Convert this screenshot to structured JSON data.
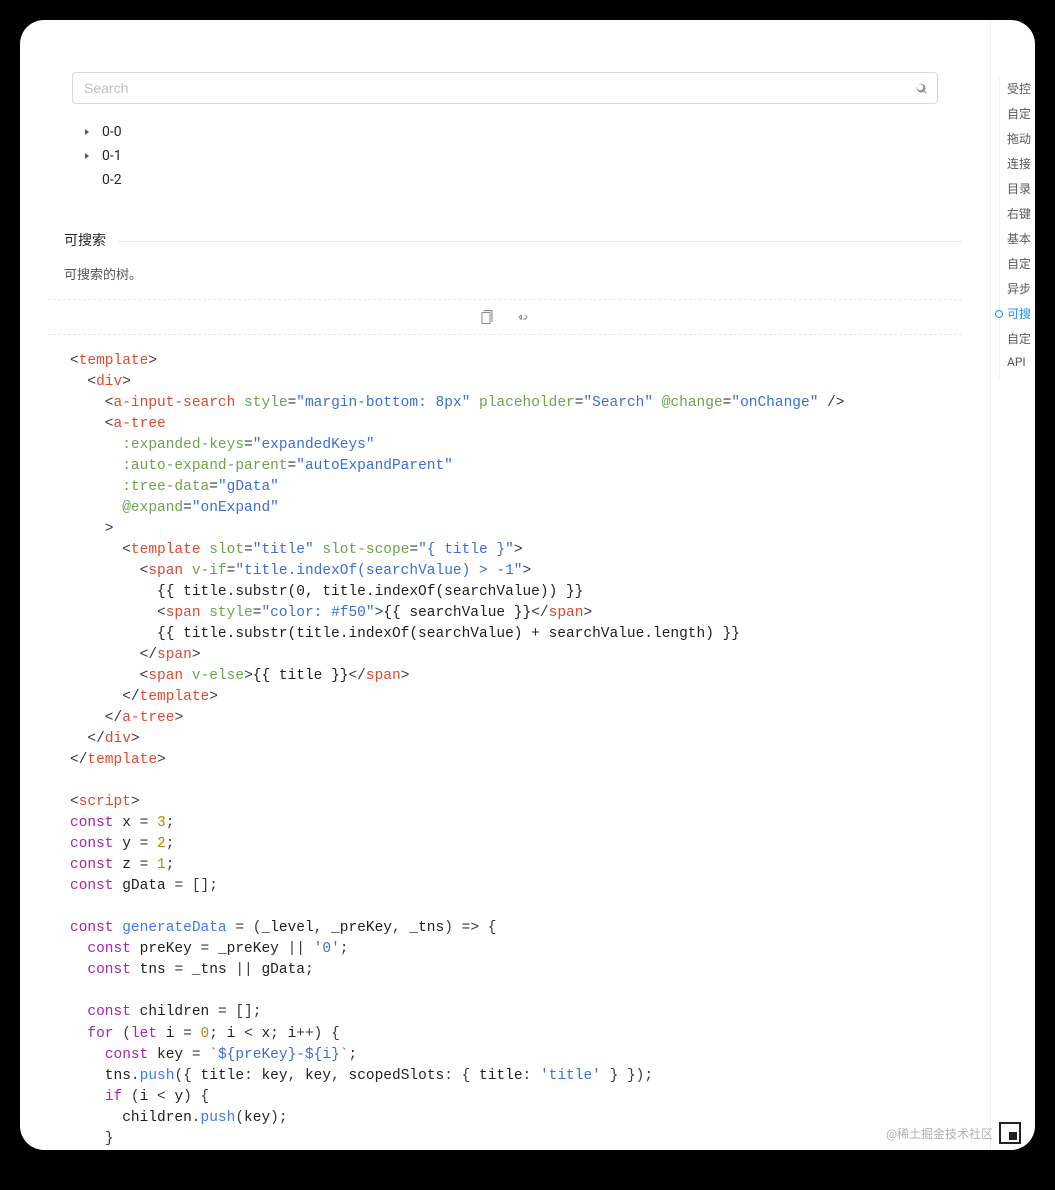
{
  "search": {
    "placeholder": "Search"
  },
  "tree": {
    "items": [
      "0-0",
      "0-1",
      "0-2"
    ]
  },
  "meta": {
    "title": "可搜索",
    "desc": "可搜索的树。"
  },
  "sidebar": {
    "items": [
      "受控",
      "自定",
      "拖动",
      "连接",
      "目录",
      "右键",
      "基本",
      "自定",
      "异步",
      "可搜",
      "自定",
      "API"
    ],
    "activeIndex": 9
  },
  "watermark": "@稀土掘金技术社区",
  "code": {
    "lines": [
      [
        [
          "punct",
          "<"
        ],
        [
          "tag",
          "template"
        ],
        [
          "punct",
          ">"
        ]
      ],
      [
        [
          "punct",
          "  <"
        ],
        [
          "tag",
          "div"
        ],
        [
          "punct",
          ">"
        ]
      ],
      [
        [
          "punct",
          "    <"
        ],
        [
          "tag",
          "a-input-search"
        ],
        [
          "plain",
          " "
        ],
        [
          "attr",
          "style"
        ],
        [
          "punct",
          "="
        ],
        [
          "str",
          "\"margin-bottom: 8px\""
        ],
        [
          "plain",
          " "
        ],
        [
          "attr",
          "placeholder"
        ],
        [
          "punct",
          "="
        ],
        [
          "str",
          "\"Search\""
        ],
        [
          "plain",
          " "
        ],
        [
          "attr",
          "@change"
        ],
        [
          "punct",
          "="
        ],
        [
          "str",
          "\"onChange\""
        ],
        [
          "plain",
          " "
        ],
        [
          "punct",
          "/>"
        ]
      ],
      [
        [
          "punct",
          "    <"
        ],
        [
          "tag",
          "a-tree"
        ]
      ],
      [
        [
          "plain",
          "      "
        ],
        [
          "attr",
          ":expanded-keys"
        ],
        [
          "punct",
          "="
        ],
        [
          "str",
          "\"expandedKeys\""
        ]
      ],
      [
        [
          "plain",
          "      "
        ],
        [
          "attr",
          ":auto-expand-parent"
        ],
        [
          "punct",
          "="
        ],
        [
          "str",
          "\"autoExpandParent\""
        ]
      ],
      [
        [
          "plain",
          "      "
        ],
        [
          "attr",
          ":tree-data"
        ],
        [
          "punct",
          "="
        ],
        [
          "str",
          "\"gData\""
        ]
      ],
      [
        [
          "plain",
          "      "
        ],
        [
          "attr",
          "@expand"
        ],
        [
          "punct",
          "="
        ],
        [
          "str",
          "\"onExpand\""
        ]
      ],
      [
        [
          "punct",
          "    >"
        ]
      ],
      [
        [
          "punct",
          "      <"
        ],
        [
          "tag",
          "template"
        ],
        [
          "plain",
          " "
        ],
        [
          "attr",
          "slot"
        ],
        [
          "punct",
          "="
        ],
        [
          "str",
          "\"title\""
        ],
        [
          "plain",
          " "
        ],
        [
          "attr",
          "slot-scope"
        ],
        [
          "punct",
          "="
        ],
        [
          "str",
          "\"{ title }\""
        ],
        [
          "punct",
          ">"
        ]
      ],
      [
        [
          "punct",
          "        <"
        ],
        [
          "tag",
          "span"
        ],
        [
          "plain",
          " "
        ],
        [
          "attr",
          "v-if"
        ],
        [
          "punct",
          "="
        ],
        [
          "str",
          "\"title.indexOf(searchValue) > -1\""
        ],
        [
          "punct",
          ">"
        ]
      ],
      [
        [
          "plain",
          "          {{ title.substr(0, title.indexOf(searchValue)) }}"
        ]
      ],
      [
        [
          "punct",
          "          <"
        ],
        [
          "tag",
          "span"
        ],
        [
          "plain",
          " "
        ],
        [
          "attr",
          "style"
        ],
        [
          "punct",
          "="
        ],
        [
          "str",
          "\"color: #f50\""
        ],
        [
          "punct",
          ">"
        ],
        [
          "plain",
          "{{ searchValue }}"
        ],
        [
          "punct",
          "</"
        ],
        [
          "tag",
          "span"
        ],
        [
          "punct",
          ">"
        ]
      ],
      [
        [
          "plain",
          "          {{ title.substr(title.indexOf(searchValue) + searchValue.length) }}"
        ]
      ],
      [
        [
          "punct",
          "        </"
        ],
        [
          "tag",
          "span"
        ],
        [
          "punct",
          ">"
        ]
      ],
      [
        [
          "punct",
          "        <"
        ],
        [
          "tag",
          "span"
        ],
        [
          "plain",
          " "
        ],
        [
          "attr",
          "v-else"
        ],
        [
          "punct",
          ">"
        ],
        [
          "plain",
          "{{ title }}"
        ],
        [
          "punct",
          "</"
        ],
        [
          "tag",
          "span"
        ],
        [
          "punct",
          ">"
        ]
      ],
      [
        [
          "punct",
          "      </"
        ],
        [
          "tag",
          "template"
        ],
        [
          "punct",
          ">"
        ]
      ],
      [
        [
          "punct",
          "    </"
        ],
        [
          "tag",
          "a-tree"
        ],
        [
          "punct",
          ">"
        ]
      ],
      [
        [
          "punct",
          "  </"
        ],
        [
          "tag",
          "div"
        ],
        [
          "punct",
          ">"
        ]
      ],
      [
        [
          "punct",
          "</"
        ],
        [
          "tag",
          "template"
        ],
        [
          "punct",
          ">"
        ]
      ],
      [
        [
          "plain",
          ""
        ]
      ],
      [
        [
          "punct",
          "<"
        ],
        [
          "tag",
          "script"
        ],
        [
          "punct",
          ">"
        ]
      ],
      [
        [
          "kw",
          "const"
        ],
        [
          "plain",
          " x "
        ],
        [
          "punct",
          "= "
        ],
        [
          "num",
          "3"
        ],
        [
          "punct",
          ";"
        ]
      ],
      [
        [
          "kw",
          "const"
        ],
        [
          "plain",
          " y "
        ],
        [
          "punct",
          "= "
        ],
        [
          "num",
          "2"
        ],
        [
          "punct",
          ";"
        ]
      ],
      [
        [
          "kw",
          "const"
        ],
        [
          "plain",
          " z "
        ],
        [
          "punct",
          "= "
        ],
        [
          "num",
          "1"
        ],
        [
          "punct",
          ";"
        ]
      ],
      [
        [
          "kw",
          "const"
        ],
        [
          "plain",
          " gData "
        ],
        [
          "punct",
          "= [];"
        ]
      ],
      [
        [
          "plain",
          ""
        ]
      ],
      [
        [
          "kw",
          "const"
        ],
        [
          "plain",
          " "
        ],
        [
          "fn",
          "generateData"
        ],
        [
          "plain",
          " "
        ],
        [
          "punct",
          "= ("
        ],
        [
          "plain",
          "_level"
        ],
        [
          "punct",
          ", "
        ],
        [
          "plain",
          "_preKey"
        ],
        [
          "punct",
          ", "
        ],
        [
          "plain",
          "_tns"
        ],
        [
          "punct",
          ") => {"
        ]
      ],
      [
        [
          "plain",
          "  "
        ],
        [
          "kw",
          "const"
        ],
        [
          "plain",
          " preKey "
        ],
        [
          "punct",
          "= "
        ],
        [
          "plain",
          "_preKey "
        ],
        [
          "punct",
          "|| "
        ],
        [
          "str",
          "'0'"
        ],
        [
          "punct",
          ";"
        ]
      ],
      [
        [
          "plain",
          "  "
        ],
        [
          "kw",
          "const"
        ],
        [
          "plain",
          " tns "
        ],
        [
          "punct",
          "= "
        ],
        [
          "plain",
          "_tns "
        ],
        [
          "punct",
          "|| "
        ],
        [
          "plain",
          "gData"
        ],
        [
          "punct",
          ";"
        ]
      ],
      [
        [
          "plain",
          ""
        ]
      ],
      [
        [
          "plain",
          "  "
        ],
        [
          "kw",
          "const"
        ],
        [
          "plain",
          " children "
        ],
        [
          "punct",
          "= [];"
        ]
      ],
      [
        [
          "plain",
          "  "
        ],
        [
          "kw",
          "for"
        ],
        [
          "plain",
          " "
        ],
        [
          "punct",
          "("
        ],
        [
          "kw",
          "let"
        ],
        [
          "plain",
          " i "
        ],
        [
          "punct",
          "= "
        ],
        [
          "num",
          "0"
        ],
        [
          "punct",
          "; "
        ],
        [
          "plain",
          "i "
        ],
        [
          "punct",
          "< "
        ],
        [
          "plain",
          "x"
        ],
        [
          "punct",
          "; "
        ],
        [
          "plain",
          "i"
        ],
        [
          "punct",
          "++) {"
        ]
      ],
      [
        [
          "plain",
          "    "
        ],
        [
          "kw",
          "const"
        ],
        [
          "plain",
          " key "
        ],
        [
          "punct",
          "= "
        ],
        [
          "str",
          "`${preKey}-${i}`"
        ],
        [
          "punct",
          ";"
        ]
      ],
      [
        [
          "plain",
          "    tns"
        ],
        [
          "punct",
          "."
        ],
        [
          "fn",
          "push"
        ],
        [
          "punct",
          "({ "
        ],
        [
          "plain",
          "title"
        ],
        [
          "punct",
          ": "
        ],
        [
          "plain",
          "key"
        ],
        [
          "punct",
          ", "
        ],
        [
          "plain",
          "key"
        ],
        [
          "punct",
          ", "
        ],
        [
          "plain",
          "scopedSlots"
        ],
        [
          "punct",
          ": { "
        ],
        [
          "plain",
          "title"
        ],
        [
          "punct",
          ": "
        ],
        [
          "str",
          "'title'"
        ],
        [
          "plain",
          " "
        ],
        [
          "punct",
          "} });"
        ]
      ],
      [
        [
          "plain",
          "    "
        ],
        [
          "kw",
          "if"
        ],
        [
          "plain",
          " "
        ],
        [
          "punct",
          "("
        ],
        [
          "plain",
          "i "
        ],
        [
          "punct",
          "< "
        ],
        [
          "plain",
          "y"
        ],
        [
          "punct",
          ") {"
        ]
      ],
      [
        [
          "plain",
          "      children"
        ],
        [
          "punct",
          "."
        ],
        [
          "fn",
          "push"
        ],
        [
          "punct",
          "("
        ],
        [
          "plain",
          "key"
        ],
        [
          "punct",
          ");"
        ]
      ],
      [
        [
          "plain",
          "    "
        ],
        [
          "punct",
          "}"
        ]
      ]
    ]
  }
}
